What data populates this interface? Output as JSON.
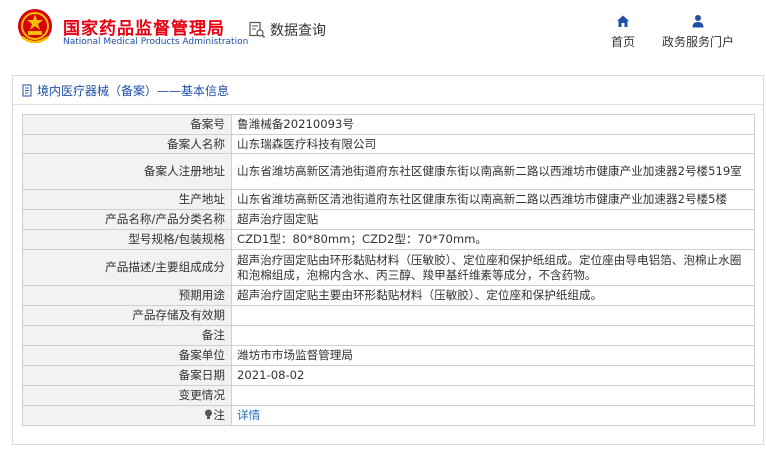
{
  "header": {
    "org_name_cn": "国家药品监督管理局",
    "org_name_en": "National Medical Products Administration",
    "data_query_label": "数据查询",
    "nav": [
      {
        "label": "首页",
        "icon": "home-icon"
      },
      {
        "label": "政务服务门户",
        "icon": "user-icon"
      }
    ]
  },
  "section": {
    "title": "境内医疗器械（备案）——基本信息"
  },
  "record": {
    "rows": [
      {
        "key": "备案号",
        "value": "鲁潍械备20210093号"
      },
      {
        "key": "备案人名称",
        "value": "山东瑞森医疗科技有限公司"
      },
      {
        "key": "备案人注册地址",
        "value": "山东省潍坊高新区清池街道府东社区健康东街以南高新二路以西潍坊市健康产业加速器2号楼519室"
      },
      {
        "key": "生产地址",
        "value": "山东省潍坊高新区清池街道府东社区健康东街以南高新二路以西潍坊市健康产业加速器2号楼5楼"
      },
      {
        "key": "产品名称/产品分类名称",
        "value": "超声治疗固定贴"
      },
      {
        "key": "型号规格/包装规格",
        "value": "CZD1型：80*80mm；CZD2型：70*70mm。"
      },
      {
        "key": "产品描述/主要组成成分",
        "value": "超声治疗固定贴由环形黏贴材料（压敏胶）、定位座和保护纸组成。定位座由导电铝箔、泡棉止水圈和泡棉组成，泡棉内含水、丙三醇、羧甲基纤维素等成分，不含药物。"
      },
      {
        "key": "预期用途",
        "value": "超声治疗固定贴主要由环形黏贴材料（压敏胶）、定位座和保护纸组成。"
      },
      {
        "key": "产品存储及有效期",
        "value": ""
      },
      {
        "key": "备注",
        "value": ""
      },
      {
        "key": "备案单位",
        "value": "潍坊市市场监督管理局"
      },
      {
        "key": "备案日期",
        "value": "2021-08-02"
      },
      {
        "key": "变更情况",
        "value": ""
      }
    ],
    "note": {
      "key": "注",
      "link": "详情",
      "icon": "bulb-icon"
    }
  },
  "colors": {
    "brand_red": "#e60012",
    "brand_blue": "#1f4fa6",
    "link": "#1f6fbf"
  }
}
